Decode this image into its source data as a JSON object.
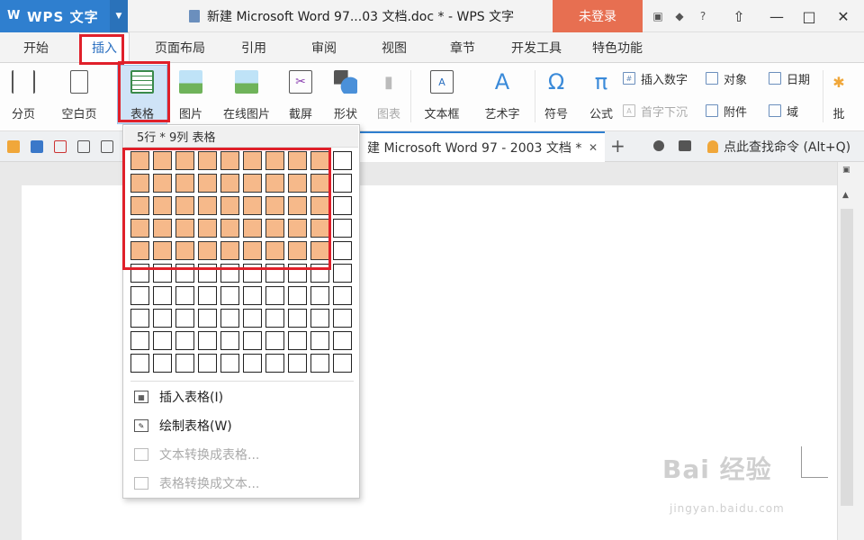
{
  "app": {
    "name": "WPS 文字",
    "doc_title": "新建 Microsoft Word 97...03 文档.doc * - WPS 文字",
    "login_label": "未登录"
  },
  "tabs": [
    {
      "label": "开始"
    },
    {
      "label": "插入",
      "active": true
    },
    {
      "label": "页面布局"
    },
    {
      "label": "引用"
    },
    {
      "label": "审阅"
    },
    {
      "label": "视图"
    },
    {
      "label": "章节"
    },
    {
      "label": "开发工具"
    },
    {
      "label": "特色功能"
    }
  ],
  "ribbon": {
    "buttons": [
      {
        "label": "分页",
        "icon": "page-break-icon"
      },
      {
        "label": "空白页",
        "icon": "blank-page-icon"
      },
      {
        "label": "表格",
        "icon": "table-icon"
      },
      {
        "label": "图片",
        "icon": "picture-icon"
      },
      {
        "label": "在线图片",
        "icon": "online-picture-icon"
      },
      {
        "label": "截屏",
        "icon": "screenshot-icon"
      },
      {
        "label": "形状",
        "icon": "shape-icon"
      },
      {
        "label": "图表",
        "icon": "chart-icon",
        "disabled": true
      },
      {
        "label": "文本框",
        "icon": "textbox-icon"
      },
      {
        "label": "艺术字",
        "icon": "wordart-icon"
      },
      {
        "label": "符号",
        "icon": "omega-icon"
      },
      {
        "label": "公式",
        "icon": "pi-icon"
      },
      {
        "label": "批",
        "icon": "comment-icon"
      }
    ],
    "small_buttons": [
      {
        "label": "插入数字"
      },
      {
        "label": "对象"
      },
      {
        "label": "日期"
      },
      {
        "label": "首字下沉",
        "disabled": true
      },
      {
        "label": "附件"
      },
      {
        "label": "域"
      }
    ]
  },
  "doc_tab": {
    "label": "建 Microsoft Word 97 - 2003 文档 *",
    "close": "✕"
  },
  "command_search": "点此查找命令 (Alt+Q)",
  "table_dropdown": {
    "header": "5行 * 9列 表格",
    "selected_rows": 5,
    "selected_cols": 9,
    "grid_rows": 10,
    "grid_cols": 10,
    "items": [
      {
        "label": "插入表格(I)",
        "disabled": false
      },
      {
        "label": "绘制表格(W)",
        "disabled": false
      },
      {
        "label": "文本转换成表格...",
        "disabled": true
      },
      {
        "label": "表格转换成文本...",
        "disabled": true
      }
    ]
  },
  "watermark": {
    "main": "Bai 经验",
    "sub": "jingyan.baidu.com"
  },
  "colors": {
    "accent": "#2f7fcf",
    "login": "#e76f51",
    "highlight": "#e0202a",
    "cell_selected": "#f6b98a"
  }
}
